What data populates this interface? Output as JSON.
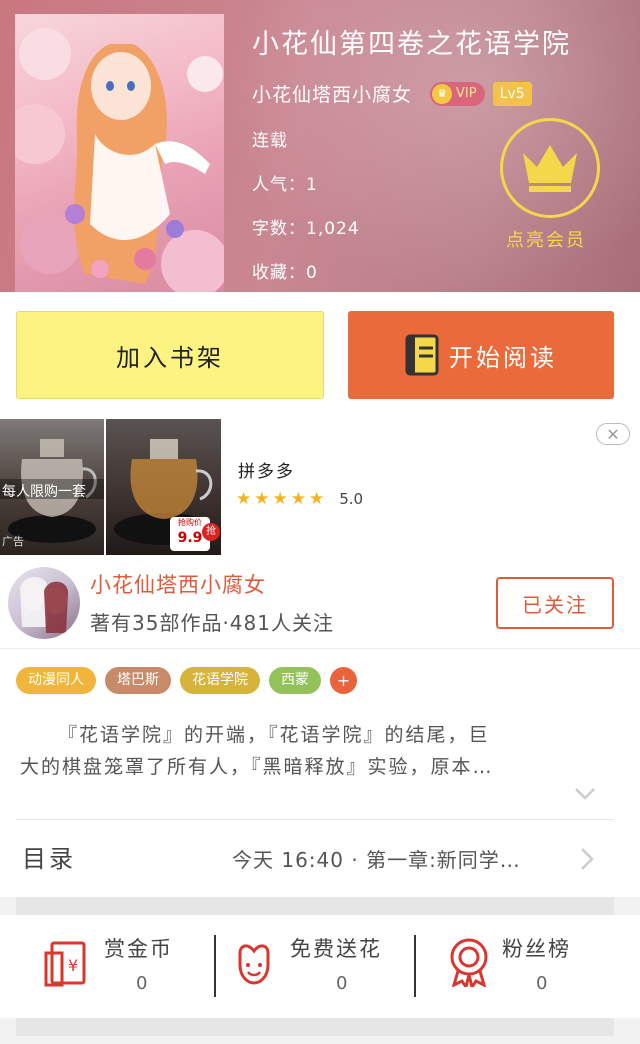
{
  "book": {
    "title": "小花仙第四卷之花语学院",
    "author": "小花仙塔西小腐女",
    "vip_label": "VIP",
    "level": "Lv5",
    "status": "连载",
    "popularity": "人气：1",
    "word_count": "字数：1,024",
    "favorites": "收藏：0",
    "membership_label": "点亮会员"
  },
  "actions": {
    "add_shelf": "加入书架",
    "start_read": "开始阅读"
  },
  "ad": {
    "name": "拼多多",
    "rating": "5.0",
    "img1_text": "每人限购一套",
    "img1_sub": "广告",
    "img2_price_label": "抢购价",
    "img2_price": "9.9",
    "img2_badge": "抢"
  },
  "author_card": {
    "name": "小花仙塔西小腐女",
    "stats": "著有35部作品·481人关注",
    "follow_label": "已关注"
  },
  "tags": [
    {
      "label": "动漫同人",
      "color": "#f0b53a"
    },
    {
      "label": "塔巴斯",
      "color": "#c98a6a"
    },
    {
      "label": "花语学院",
      "color": "#d6b33a"
    },
    {
      "label": "西蒙",
      "color": "#93c25a"
    }
  ],
  "tag_add": "+",
  "synopsis": {
    "line1": "『花语学院』的开端，『花语学院』的结尾，巨",
    "line2": "大的棋盘笼罩了所有人，『黑暗释放』实验，原本…"
  },
  "toc": {
    "label": "目录",
    "latest": "今天 16:40 · 第一章:新同学…"
  },
  "bottom_stats": [
    {
      "label": "赏金币",
      "value": "0"
    },
    {
      "label": "免费送花",
      "value": "0"
    },
    {
      "label": "粉丝榜",
      "value": "0"
    }
  ],
  "colors": {
    "accent_orange": "#ea6a3c",
    "shelf_yellow": "#fdf383",
    "gold": "#f5d84a",
    "red_text": "#e05b3c"
  },
  "icons": {
    "member": "crown-icon",
    "read": "book-icon",
    "coin": "red-envelope-icon",
    "flower": "flower-icon",
    "rank": "medal-icon"
  }
}
